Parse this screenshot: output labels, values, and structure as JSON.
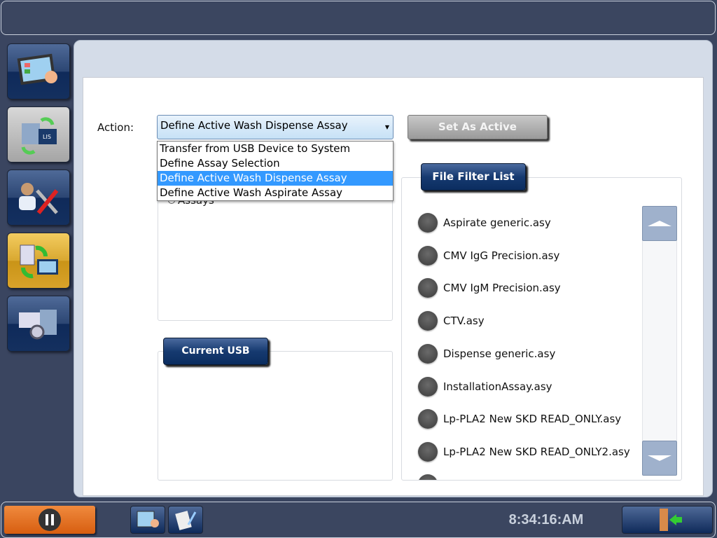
{
  "nav": {
    "items": [
      {
        "icon": "touch-screen-icon",
        "active": false
      },
      {
        "icon": "lis-link-icon",
        "active": false
      },
      {
        "icon": "service-tools-icon",
        "active": false
      },
      {
        "icon": "file-transfer-icon",
        "active": true
      },
      {
        "icon": "instrument-settings-icon",
        "active": false
      }
    ]
  },
  "action": {
    "label": "Action:",
    "selected": "Define Active Wash Dispense Assay",
    "options": [
      "Transfer from USB Device to System",
      "Define Assay Selection",
      "Define Active Wash Dispense Assay",
      "Define Active Wash Aspirate Assay"
    ]
  },
  "set_active_label": "Set As Active",
  "assays_radio_label": "Assays",
  "usb_devices_label": "Current USB Devices",
  "file_filter_label": "File Filter List",
  "files": [
    "Aspirate generic.asy",
    "CMV IgG Precision.asy",
    "CMV IgM Precision.asy",
    "CTV.asy",
    "Dispense generic.asy",
    "InstallationAssay.asy",
    "Lp-PLA2 New SKD READ_ONLY.asy",
    "Lp-PLA2 New SKD READ_ONLY2.asy"
  ],
  "footer": {
    "time": "8:34:16:AM"
  },
  "colors": {
    "accent_orange": "#d75e10",
    "nav_blue": "#14305f",
    "selection": "#3399ff"
  }
}
